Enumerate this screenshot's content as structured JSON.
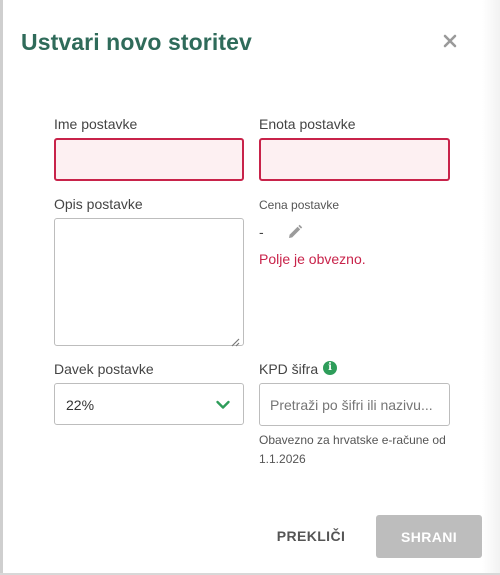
{
  "dialog": {
    "title": "Ustvari novo storitev",
    "close_icon": "close-icon"
  },
  "form": {
    "item_name": {
      "label": "Ime postavke",
      "value": "",
      "state": "error"
    },
    "item_unit": {
      "label": "Enota postavke",
      "value": "",
      "state": "error"
    },
    "item_description": {
      "label": "Opis postavke",
      "value": ""
    },
    "item_price": {
      "label": "Cena postavke",
      "value": "-",
      "edit_icon": "pencil-icon",
      "error": "Polje je obvezno."
    },
    "tax": {
      "label": "Davek postavke",
      "selected": "22%",
      "icon": "chevron-down-icon"
    },
    "kpd": {
      "label": "KPD šifra",
      "info_icon": "info-icon",
      "info_glyph": "i",
      "placeholder": "Pretraži po šifri ili nazivu...",
      "value": "",
      "helper": "Obavezno za hrvatske e-račune od 1.1.2026"
    }
  },
  "actions": {
    "cancel_label": "PREKLIČI",
    "save_label": "SHRANI"
  },
  "colors": {
    "title": "#2f6b5a",
    "error": "#c8234a",
    "error_bg": "#fdf0f2",
    "accent_green": "#2e9d5a",
    "save_disabled": "#bdbdbd"
  }
}
